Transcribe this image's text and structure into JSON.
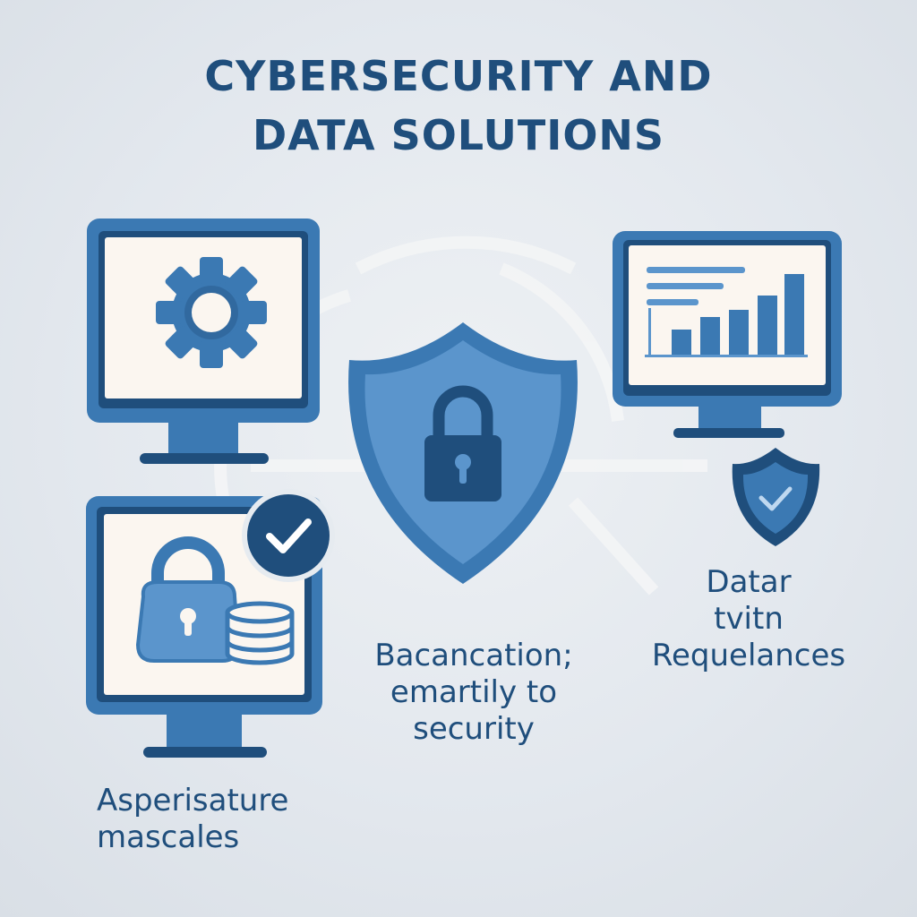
{
  "title": {
    "line1": "CYBERSECURITY AND",
    "line2": "DATA SOLUTIONS"
  },
  "captions": {
    "left": [
      "Asperisature",
      "mascales"
    ],
    "middle": [
      "Bacancation;",
      "emartily to",
      "security"
    ],
    "right": [
      "Datar",
      "tvitn",
      "Requelances"
    ]
  },
  "colors": {
    "dark_blue": "#1f4e7c",
    "mid_blue": "#3b79b3",
    "light_blue": "#5b95cc",
    "screen": "#fbf6f0",
    "background": "#e3e8ee"
  },
  "icons": [
    "gear-icon",
    "bar-chart-icon",
    "shield-lock-icon",
    "padlock-icon",
    "database-icon",
    "checkmark-badge-icon",
    "small-shield-check-icon"
  ]
}
